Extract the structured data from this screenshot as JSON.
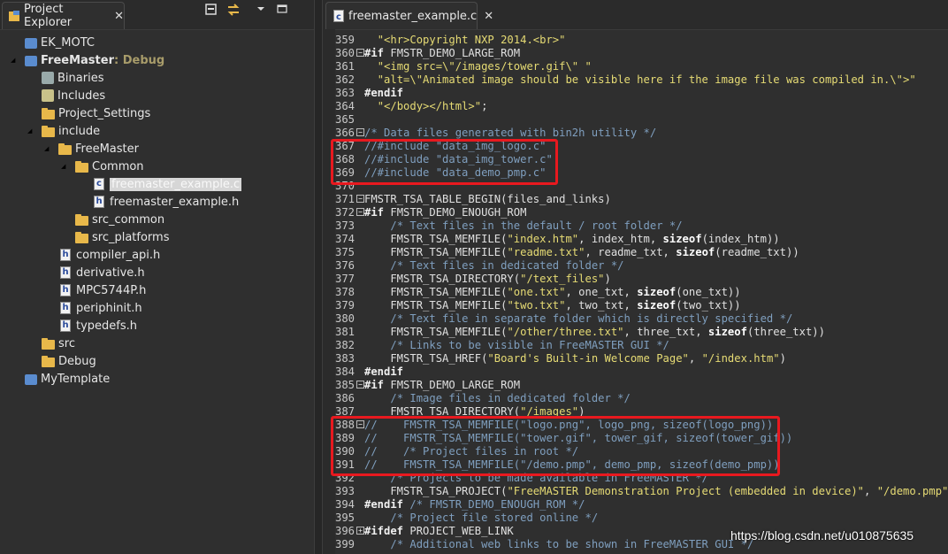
{
  "explorer": {
    "tab_title": "Project Explorer",
    "toolbar_icons": [
      "collapse-all-icon",
      "link-editor-icon",
      "view-menu-icon",
      "minimize-icon"
    ],
    "items": [
      {
        "label": "EK_MOTC",
        "icon": "project-icon",
        "depth": 0
      },
      {
        "label": "FreeMaster",
        "suffix": ": Debug",
        "icon": "project-open-icon",
        "depth": 0,
        "expanded": true
      },
      {
        "label": "Binaries",
        "icon": "binaries-icon",
        "depth": 1
      },
      {
        "label": "Includes",
        "icon": "includes-icon",
        "depth": 1
      },
      {
        "label": "Project_Settings",
        "icon": "folder-icon",
        "depth": 1
      },
      {
        "label": "include",
        "icon": "folder-icon",
        "depth": 1,
        "expanded": true
      },
      {
        "label": "FreeMaster",
        "icon": "folder-icon",
        "depth": 2,
        "expanded": true
      },
      {
        "label": "Common",
        "icon": "folder-icon",
        "depth": 3,
        "expanded": true
      },
      {
        "label": "freemaster_example.c",
        "icon": "c-file-icon",
        "depth": 4,
        "selected": true
      },
      {
        "label": "freemaster_example.h",
        "icon": "h-file-icon",
        "depth": 4
      },
      {
        "label": "src_common",
        "icon": "folder-icon",
        "depth": 3
      },
      {
        "label": "src_platforms",
        "icon": "folder-icon",
        "depth": 3
      },
      {
        "label": "compiler_api.h",
        "icon": "h-file-icon",
        "depth": 2
      },
      {
        "label": "derivative.h",
        "icon": "h-file-icon",
        "depth": 2
      },
      {
        "label": "MPC5744P.h",
        "icon": "h-file-icon",
        "depth": 2
      },
      {
        "label": "periphinit.h",
        "icon": "h-file-icon",
        "depth": 2
      },
      {
        "label": "typedefs.h",
        "icon": "h-file-icon",
        "depth": 2
      },
      {
        "label": "src",
        "icon": "folder-icon",
        "depth": 1
      },
      {
        "label": "Debug",
        "icon": "folder-icon",
        "depth": 1
      },
      {
        "label": "MyTemplate",
        "icon": "project-icon",
        "depth": 0
      }
    ]
  },
  "editor": {
    "tab_title": "freemaster_example.c",
    "lines": [
      {
        "n": "359",
        "fold": "",
        "parts": [
          [
            "plain",
            "  "
          ],
          [
            "str",
            "\"<hr>Copyright NXP 2014.<br>\""
          ]
        ]
      },
      {
        "n": "360",
        "fold": "-",
        "parts": [
          [
            "pp",
            "#if"
          ],
          [
            "plain",
            " FMSTR_DEMO_LARGE_ROM"
          ]
        ]
      },
      {
        "n": "361",
        "fold": "",
        "parts": [
          [
            "plain",
            "  "
          ],
          [
            "str",
            "\"<img src=\\\"/images/tower.gif\\\" \""
          ]
        ]
      },
      {
        "n": "362",
        "fold": "",
        "parts": [
          [
            "plain",
            "  "
          ],
          [
            "str",
            "\"alt=\\\"Animated image should be visible here if the image file was compiled in.\\\">\""
          ]
        ]
      },
      {
        "n": "363",
        "fold": "",
        "parts": [
          [
            "pp",
            "#endif"
          ]
        ]
      },
      {
        "n": "364",
        "fold": "",
        "parts": [
          [
            "plain",
            "  "
          ],
          [
            "str",
            "\"</body></html>\""
          ],
          [
            "plain",
            ";"
          ]
        ]
      },
      {
        "n": "365",
        "fold": "",
        "parts": []
      },
      {
        "n": "366",
        "fold": "-",
        "parts": [
          [
            "com",
            "/* Data files generated with bin2h utility */"
          ]
        ]
      },
      {
        "n": "367",
        "fold": "",
        "parts": [
          [
            "com",
            "//#include \"data_img_logo.c\""
          ]
        ]
      },
      {
        "n": "368",
        "fold": "",
        "parts": [
          [
            "com",
            "//#include \"data_img_tower.c\""
          ]
        ]
      },
      {
        "n": "369",
        "fold": "",
        "parts": [
          [
            "com",
            "//#include \"data_demo_pmp.c\""
          ]
        ]
      },
      {
        "n": "370",
        "fold": "",
        "parts": []
      },
      {
        "n": "371",
        "fold": "-",
        "parts": [
          [
            "plain",
            "FMSTR_TSA_TABLE_BEGIN(files_and_links)"
          ]
        ]
      },
      {
        "n": "372",
        "fold": "-",
        "parts": [
          [
            "pp",
            "#if"
          ],
          [
            "plain",
            " FMSTR_DEMO_ENOUGH_ROM"
          ]
        ]
      },
      {
        "n": "373",
        "fold": "",
        "parts": [
          [
            "plain",
            "    "
          ],
          [
            "com",
            "/* Text files in the default / root folder */"
          ]
        ]
      },
      {
        "n": "374",
        "fold": "",
        "parts": [
          [
            "plain",
            "    FMSTR_TSA_MEMFILE("
          ],
          [
            "str",
            "\"index.htm\""
          ],
          [
            "plain",
            ", index_htm, "
          ],
          [
            "kw",
            "sizeof"
          ],
          [
            "plain",
            "(index_htm))"
          ]
        ]
      },
      {
        "n": "375",
        "fold": "",
        "parts": [
          [
            "plain",
            "    FMSTR_TSA_MEMFILE("
          ],
          [
            "str",
            "\"readme.txt\""
          ],
          [
            "plain",
            ", readme_txt, "
          ],
          [
            "kw",
            "sizeof"
          ],
          [
            "plain",
            "(readme_txt))"
          ]
        ]
      },
      {
        "n": "376",
        "fold": "",
        "parts": [
          [
            "plain",
            "    "
          ],
          [
            "com",
            "/* Text files in dedicated folder */"
          ]
        ]
      },
      {
        "n": "377",
        "fold": "",
        "parts": [
          [
            "plain",
            "    FMSTR_TSA_DIRECTORY("
          ],
          [
            "str",
            "\"/text_files\""
          ],
          [
            "plain",
            ")"
          ]
        ]
      },
      {
        "n": "378",
        "fold": "",
        "parts": [
          [
            "plain",
            "    FMSTR_TSA_MEMFILE("
          ],
          [
            "str",
            "\"one.txt\""
          ],
          [
            "plain",
            ", one_txt, "
          ],
          [
            "kw",
            "sizeof"
          ],
          [
            "plain",
            "(one_txt))"
          ]
        ]
      },
      {
        "n": "379",
        "fold": "",
        "parts": [
          [
            "plain",
            "    FMSTR_TSA_MEMFILE("
          ],
          [
            "str",
            "\"two.txt\""
          ],
          [
            "plain",
            ", two_txt, "
          ],
          [
            "kw",
            "sizeof"
          ],
          [
            "plain",
            "(two_txt))"
          ]
        ]
      },
      {
        "n": "380",
        "fold": "",
        "parts": [
          [
            "plain",
            "    "
          ],
          [
            "com",
            "/* Text file in separate folder which is directly specified */"
          ]
        ]
      },
      {
        "n": "381",
        "fold": "",
        "parts": [
          [
            "plain",
            "    FMSTR_TSA_MEMFILE("
          ],
          [
            "str",
            "\"/other/three.txt\""
          ],
          [
            "plain",
            ", three_txt, "
          ],
          [
            "kw",
            "sizeof"
          ],
          [
            "plain",
            "(three_txt))"
          ]
        ]
      },
      {
        "n": "382",
        "fold": "",
        "parts": [
          [
            "plain",
            "    "
          ],
          [
            "com",
            "/* Links to be visible in FreeMASTER GUI */"
          ]
        ]
      },
      {
        "n": "383",
        "fold": "",
        "parts": [
          [
            "plain",
            "    FMSTR_TSA_HREF("
          ],
          [
            "str",
            "\"Board's Built-in Welcome Page\""
          ],
          [
            "plain",
            ", "
          ],
          [
            "str",
            "\"/index.htm\""
          ],
          [
            "plain",
            ")"
          ]
        ]
      },
      {
        "n": "384",
        "fold": "",
        "parts": [
          [
            "pp",
            "#endif"
          ]
        ]
      },
      {
        "n": "385",
        "fold": "-",
        "parts": [
          [
            "pp",
            "#if"
          ],
          [
            "plain",
            " FMSTR_DEMO_LARGE_ROM"
          ]
        ]
      },
      {
        "n": "386",
        "fold": "",
        "parts": [
          [
            "plain",
            "    "
          ],
          [
            "com",
            "/* Image files in dedicated folder */"
          ]
        ]
      },
      {
        "n": "387",
        "fold": "",
        "parts": [
          [
            "plain",
            "    FMSTR_TSA_DIRECTORY("
          ],
          [
            "str",
            "\"/images\""
          ],
          [
            "plain",
            ")"
          ]
        ]
      },
      {
        "n": "388",
        "fold": "-",
        "parts": [
          [
            "com",
            "//    FMSTR_TSA_MEMFILE(\"logo.png\", logo_png, sizeof(logo_png))"
          ]
        ]
      },
      {
        "n": "389",
        "fold": "",
        "parts": [
          [
            "com",
            "//    FMSTR_TSA_MEMFILE(\"tower.gif\", tower_gif, sizeof(tower_gif))"
          ]
        ]
      },
      {
        "n": "390",
        "fold": "",
        "parts": [
          [
            "com",
            "//    /* Project files in root */"
          ]
        ]
      },
      {
        "n": "391",
        "fold": "",
        "parts": [
          [
            "com",
            "//    FMSTR_TSA_MEMFILE(\"/demo.pmp\", demo_pmp, sizeof(demo_pmp))"
          ]
        ]
      },
      {
        "n": "392",
        "fold": "",
        "parts": [
          [
            "plain",
            "    "
          ],
          [
            "com",
            "/* Projects to be made available in FreeMASTER */"
          ]
        ]
      },
      {
        "n": "393",
        "fold": "",
        "parts": [
          [
            "plain",
            "    FMSTR_TSA_PROJECT("
          ],
          [
            "str",
            "\"FreeMASTER Demonstration Project (embedded in device)\""
          ],
          [
            "plain",
            ", "
          ],
          [
            "str",
            "\"/demo.pmp\""
          ],
          [
            "plain",
            ")"
          ]
        ]
      },
      {
        "n": "394",
        "fold": "",
        "parts": [
          [
            "pp",
            "#endif"
          ],
          [
            "plain",
            " "
          ],
          [
            "com",
            "/* FMSTR_DEMO_ENOUGH_ROM */"
          ]
        ]
      },
      {
        "n": "395",
        "fold": "",
        "parts": [
          [
            "plain",
            "    "
          ],
          [
            "com",
            "/* Project file stored online */"
          ]
        ]
      },
      {
        "n": "396",
        "fold": "+",
        "parts": [
          [
            "pp",
            "#ifdef"
          ],
          [
            "plain",
            " PROJECT_WEB_LINK"
          ]
        ]
      },
      {
        "n": "399",
        "fold": "",
        "parts": [
          [
            "plain",
            "    "
          ],
          [
            "com",
            "/* Additional web links to be shown in FreeMASTER GUI */"
          ]
        ]
      }
    ]
  },
  "watermark": "https://blog.csdn.net/u010875635",
  "colors": {
    "highlight_box": "#e8191f",
    "comment": "#7f9fbf",
    "string": "#e6db74",
    "folder": "#e8b84a"
  }
}
